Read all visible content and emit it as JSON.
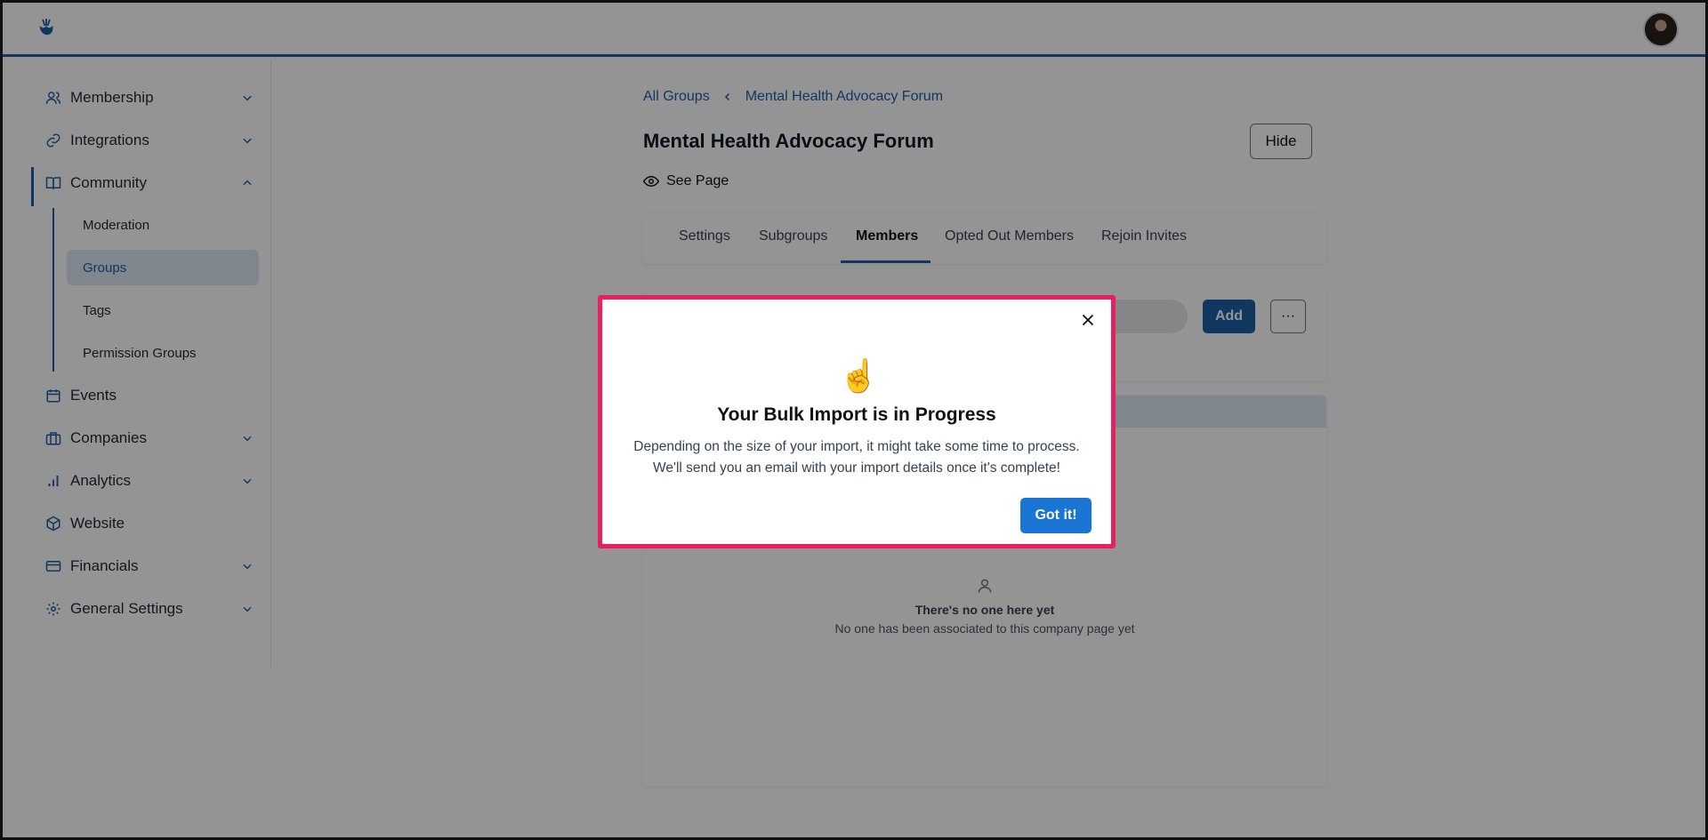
{
  "sidebar": {
    "items": [
      {
        "label": "Membership",
        "icon": "users-icon"
      },
      {
        "label": "Integrations",
        "icon": "link-icon"
      },
      {
        "label": "Community",
        "icon": "book-icon"
      },
      {
        "label": "Events",
        "icon": "calendar-icon"
      },
      {
        "label": "Companies",
        "icon": "briefcase-icon"
      },
      {
        "label": "Analytics",
        "icon": "bar-chart-icon"
      },
      {
        "label": "Website",
        "icon": "cube-icon"
      },
      {
        "label": "Financials",
        "icon": "credit-card-icon"
      },
      {
        "label": "General Settings",
        "icon": "gear-icon"
      }
    ],
    "community_sub": [
      "Moderation",
      "Groups",
      "Tags",
      "Permission Groups"
    ],
    "active_sub": "Groups"
  },
  "breadcrumb": {
    "parent": "All Groups",
    "current": "Mental Health Advocacy Forum"
  },
  "page": {
    "title": "Mental Health Advocacy Forum",
    "hide_label": "Hide",
    "see_page_label": "See Page"
  },
  "tabs": [
    "Settings",
    "Subgroups",
    "Members",
    "Opted Out Members",
    "Rejoin Invites"
  ],
  "active_tab": "Members",
  "members": {
    "add_label": "Add",
    "more_label": "···"
  },
  "empty_state": {
    "title": "There's no one here yet",
    "subtitle": "No one has been associated to this company page yet"
  },
  "modal": {
    "emoji": "☝️",
    "title": "Your Bulk Import is in Progress",
    "line1": "Depending on the size of your import, it might take some time to process.",
    "line2": "We'll send you an email with your import details once it's complete!",
    "button": "Got it!"
  },
  "colors": {
    "accent": "#1e5fa8",
    "modal_border": "#ea1f5f",
    "button": "#1976d2"
  }
}
